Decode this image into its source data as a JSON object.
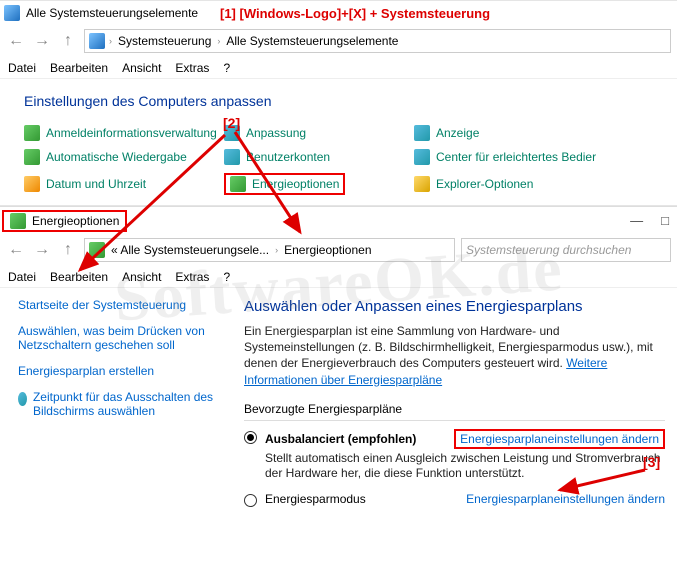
{
  "annotations": {
    "a1": "[1]  [Windows-Logo]+[X] + Systemsteuerung",
    "a2": "[2]",
    "a3": "[3]"
  },
  "watermark": "SoftwareOK.de",
  "window1": {
    "title": "Alle Systemsteuerungselemente",
    "win_controls": {
      "min": "—",
      "max": "□",
      "close": "✕"
    },
    "nav": {
      "back": "←",
      "fwd": "→",
      "up": "↑"
    },
    "breadcrumbs": [
      "Systemsteuerung",
      "Alle Systemsteuerungselemente"
    ],
    "menubar": [
      "Datei",
      "Bearbeiten",
      "Ansicht",
      "Extras",
      "?"
    ],
    "heading": "Einstellungen des Computers anpassen",
    "items": [
      {
        "label": "Anmeldeinformationsverwaltung"
      },
      {
        "label": "Anpassung"
      },
      {
        "label": "Anzeige"
      },
      {
        "label": "Automatische Wiedergabe"
      },
      {
        "label": "Benutzerkonten"
      },
      {
        "label": "Center für erleichtertes Bedier"
      },
      {
        "label": "Datum und Uhrzeit"
      },
      {
        "label": "Energieoptionen"
      },
      {
        "label": "Explorer-Optionen"
      }
    ]
  },
  "window2": {
    "title": "Energieoptionen",
    "win_controls": {
      "min": "—",
      "max": "□"
    },
    "nav": {
      "back": "←",
      "fwd": "→",
      "up": "↑"
    },
    "breadcrumbs": [
      "« Alle Systemsteuerungsele...",
      "Energieoptionen"
    ],
    "search_placeholder": "Systemsteuerung durchsuchen",
    "menubar": [
      "Datei",
      "Bearbeiten",
      "Ansicht",
      "Extras",
      "?"
    ],
    "sidebar": {
      "home": "Startseite der Systemsteuerung",
      "links": [
        "Auswählen, was beim Drücken von Netzschaltern geschehen soll",
        "Energiesparplan erstellen",
        "Zeitpunkt für das Ausschalten des Bildschirms auswählen"
      ]
    },
    "heading": "Auswählen oder Anpassen eines Energiesparplans",
    "description": "Ein Energiesparplan ist eine Sammlung von Hardware- und Systemeinstellungen (z. B. Bildschirmhelligkeit, Energiesparmodus usw.), mit denen der Energieverbrauch des Computers gesteuert wird. ",
    "description_link": "Weitere Informationen über Energiesparpläne",
    "preferred_label": "Bevorzugte Energiesparpläne",
    "plans": [
      {
        "selected": true,
        "name": "Ausbalanciert (empfohlen)",
        "desc": "Stellt automatisch einen Ausgleich zwischen Leistung und Stromverbrauch der Hardware her, die diese Funktion unterstützt.",
        "link": "Energiesparplaneinstellungen ändern"
      },
      {
        "selected": false,
        "name": "Energiesparmodus",
        "desc": "",
        "link": "Energiesparplaneinstellungen ändern"
      }
    ]
  }
}
